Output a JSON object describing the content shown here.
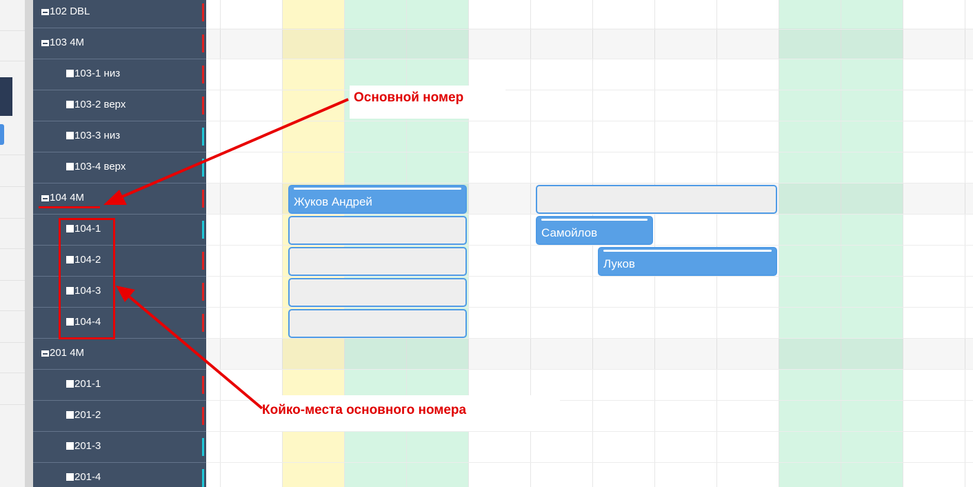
{
  "sidebar": {
    "rooms": [
      {
        "label": "102 DBL",
        "kind": "parent-collapsed",
        "marker": "#e02020"
      },
      {
        "label": "103 4M",
        "kind": "parent",
        "marker": "#e02020"
      },
      {
        "label": "103-1 низ",
        "kind": "child",
        "marker": "#e02020"
      },
      {
        "label": "103-2 верх",
        "kind": "child",
        "marker": "#e02020"
      },
      {
        "label": "103-3 низ",
        "kind": "child",
        "marker": "#1ec8d8"
      },
      {
        "label": "103-4 верх",
        "kind": "child",
        "marker": "#1ec8d8"
      },
      {
        "label": "104 4M",
        "kind": "parent",
        "marker": "#e02020"
      },
      {
        "label": "104-1",
        "kind": "child",
        "marker": "#1ec8d8"
      },
      {
        "label": "104-2",
        "kind": "child",
        "marker": "#e02020"
      },
      {
        "label": "104-3",
        "kind": "child",
        "marker": "#e02020"
      },
      {
        "label": "104-4",
        "kind": "child",
        "marker": "#e02020"
      },
      {
        "label": "201 4M",
        "kind": "parent",
        "marker": "#405066"
      },
      {
        "label": "201-1",
        "kind": "child",
        "marker": "#e02020"
      },
      {
        "label": "201-2",
        "kind": "child",
        "marker": "#e02020"
      },
      {
        "label": "201-3",
        "kind": "child",
        "marker": "#1ec8d8"
      },
      {
        "label": "201-4",
        "kind": "child",
        "marker": "#1ec8d8"
      }
    ]
  },
  "bookings": [
    {
      "guest": "Жуков Андрей",
      "state": "filled"
    },
    {
      "guest": "",
      "state": "empty"
    },
    {
      "guest": "",
      "state": "empty"
    },
    {
      "guest": "",
      "state": "empty"
    },
    {
      "guest": "",
      "state": "empty"
    },
    {
      "guest": "",
      "state": "empty"
    },
    {
      "guest": "Самойлов",
      "state": "filled"
    },
    {
      "guest": "Луков",
      "state": "filled"
    }
  ],
  "annotations": {
    "main_room": "Основной номер",
    "beds": "Койко-места основного номера"
  },
  "colors": {
    "sidebar_bg": "#405066",
    "today_column": "#fef8c6",
    "weekend_column": "#d5f5e3",
    "booking_filled": "#58a0e6",
    "booking_empty": "#eeeeee",
    "annotation_red": "#e00000",
    "marker_red": "#e02020",
    "marker_cyan": "#1ec8d8"
  }
}
